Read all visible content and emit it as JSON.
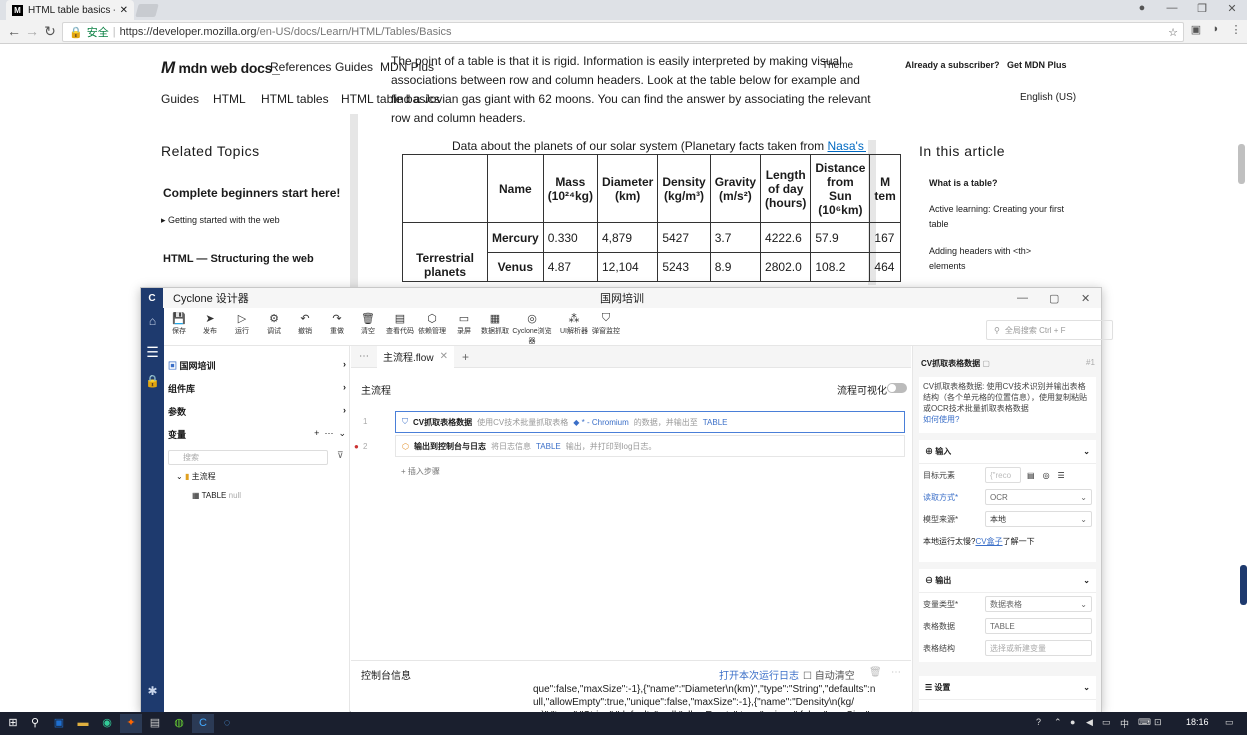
{
  "browser": {
    "tab_title": "HTML table basics - Lea",
    "tab_favicon": "M",
    "security_label": "安全",
    "url_prefix": "https://developer.mozilla.org",
    "url_path": "/en-US/docs/Learn/HTML/Tables/Basics"
  },
  "mdn": {
    "logo": "mdn web docs",
    "nav": [
      "References",
      "Guides",
      "MDN Plus"
    ],
    "theme": "Theme",
    "subscriber": "Already a subscriber?",
    "get_plus": "Get MDN Plus",
    "breadcrumbs": [
      "Guides",
      "HTML",
      "HTML tables",
      "HTML table basics"
    ],
    "language": "English (US)",
    "intro": "The point of a table is that it is rigid. Information is easily interpreted by making visual associations between row and column headers. Look at the table below for example and find a Jovian gas giant with 62 moons. You can find the answer by associating the relevant row and column headers.",
    "sidebar": {
      "heading": "Related Topics",
      "sec1": "Complete beginners start here!",
      "sec1_item": "Getting started with the web",
      "sec2": "HTML — Structuring the web"
    },
    "toc": {
      "heading": "In this article",
      "items": [
        "What is a table?",
        "Active learning: Creating your first table",
        "Adding headers with <th> elements"
      ]
    },
    "table": {
      "caption_text": "Data about the planets of our solar system (Planetary facts taken from ",
      "caption_link": "Nasa's Plane",
      "headers": [
        "Name",
        "Mass (10²⁴kg)",
        "Diameter (km)",
        "Density (kg/m³)",
        "Gravity (m/s²)",
        "Length of day (hours)",
        "Distance from Sun (10⁶km)",
        "M tem"
      ],
      "group": "Terrestrial planets",
      "rows": [
        [
          "Mercury",
          "0.330",
          "4,879",
          "5427",
          "3.7",
          "4222.6",
          "57.9",
          "167"
        ],
        [
          "Venus",
          "4.87",
          "12,104",
          "5243",
          "8.9",
          "2802.0",
          "108.2",
          "464"
        ]
      ]
    }
  },
  "cyclone": {
    "app_title": "Cyclone 设计器",
    "project_title": "国网培训",
    "toolbar": [
      "保存",
      "发布",
      "运行",
      "调试",
      "撤销",
      "重做",
      "清空",
      "查看代码",
      "依赖管理",
      "录屏",
      "数据抓取",
      "Cyclone浏览器",
      "UI解析器",
      "弹窗监控"
    ],
    "search_placeholder": "全局搜索 Ctrl + F",
    "left": {
      "project": "国网培训",
      "components": "组件库",
      "params": "参数",
      "variables": "变量",
      "var_search": "搜索",
      "tree_root": "主流程",
      "tree_var": "TABLE",
      "tree_var_value": "null"
    },
    "main": {
      "tab": "主流程.flow",
      "flow_title": "主流程",
      "visualize_label": "流程可视化",
      "steps": [
        {
          "num": "1",
          "name": "CV抓取表格数据",
          "desc": "使用CV技术批量抓取表格",
          "target": "◆ * - Chromium",
          "desc2": "的数据，并输出至",
          "out": "TABLE"
        },
        {
          "num": "2",
          "name": "输出到控制台与日志",
          "desc": "将日志信息",
          "target": "TABLE",
          "desc2": "输出，并打印到log日志。",
          "out": ""
        }
      ],
      "add_step": "插入步骤",
      "console_title": "控制台信息",
      "console_open_log": "打开本次运行日志",
      "console_autoclear": "自动清空",
      "console_text": "que\":false,\"maxSize\":-1},{\"name\":\"Diameter\\n(km)\",\"type\":\"String\",\"defaults\":null,\"allowEmpty\":true,\"unique\":false,\"maxSize\":-1},{\"name\":\"Density\\n(kg/m)\",\"type\":\"String\",\"defaults\":null,\"allowEmpty\":true,\"unique\":false,\"maxSize\":-1},{\"nam"
    },
    "right": {
      "title": "CV抓取表格数据",
      "step_no": "#1",
      "desc": "CV抓取表格数据: 使用CV技术识别并输出表格结构（各个单元格的位置信息），使用复制粘贴或OCR技术批量抓取表格数据",
      "help": "如何使用?",
      "input_label": "输入",
      "target_label": "目标元素",
      "target_value": "{\"reco",
      "read_label": "读取方式*",
      "read_value": "OCR",
      "model_label": "模型来源*",
      "model_value": "本地",
      "hint_prefix": "本地运行太慢?",
      "hint_link": "CV盒子",
      "hint_suffix": "了解一下",
      "output_label": "输出",
      "vartype_label": "变量类型*",
      "vartype_value": "数据表格",
      "tabledata_label": "表格数据",
      "tabledata_value": "TABLE",
      "struct_label": "表格结构",
      "struct_placeholder": "选择或新建变量",
      "settings_label": "设置"
    }
  },
  "taskbar": {
    "time": "18:16",
    "ime": "中"
  }
}
